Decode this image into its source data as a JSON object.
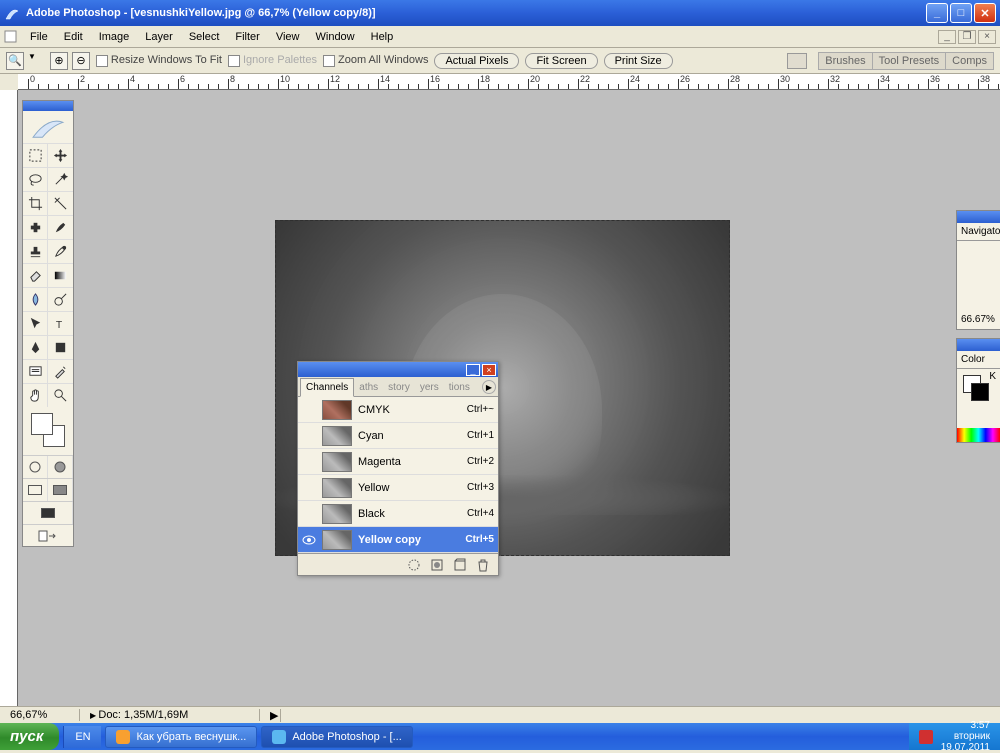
{
  "titlebar": {
    "text": "Adobe Photoshop - [vesnushkiYellow.jpg @ 66,7% (Yellow copy/8)]"
  },
  "menu": {
    "items": [
      "File",
      "Edit",
      "Image",
      "Layer",
      "Select",
      "Filter",
      "View",
      "Window",
      "Help"
    ]
  },
  "options": {
    "resize": "Resize Windows To Fit",
    "ignore": "Ignore Palettes",
    "zoomall": "Zoom All Windows",
    "actual": "Actual Pixels",
    "fit": "Fit Screen",
    "print": "Print Size",
    "well_tabs": [
      "Brushes",
      "Tool Presets",
      "Comps"
    ]
  },
  "ruler": {
    "labels": [
      "0",
      "2",
      "4",
      "6",
      "8",
      "10",
      "12",
      "14",
      "16",
      "18",
      "20",
      "22",
      "24",
      "26",
      "28",
      "30",
      "32",
      "34",
      "36",
      "38"
    ]
  },
  "channels_panel": {
    "tabs": [
      "Channels",
      "aths",
      "story",
      "yers",
      "tions"
    ],
    "rows": [
      {
        "name": "CMYK",
        "shortcut": "Ctrl+~",
        "thumb": "cmyk",
        "eye": false
      },
      {
        "name": "Cyan",
        "shortcut": "Ctrl+1",
        "thumb": "gray",
        "eye": false
      },
      {
        "name": "Magenta",
        "shortcut": "Ctrl+2",
        "thumb": "gray",
        "eye": false
      },
      {
        "name": "Yellow",
        "shortcut": "Ctrl+3",
        "thumb": "gray",
        "eye": false
      },
      {
        "name": "Black",
        "shortcut": "Ctrl+4",
        "thumb": "gray",
        "eye": false
      },
      {
        "name": "Yellow copy",
        "shortcut": "Ctrl+5",
        "thumb": "gray",
        "eye": true,
        "selected": true
      }
    ]
  },
  "navigator": {
    "tab": "Navigator",
    "zoom": "66.67%"
  },
  "color": {
    "tab": "Color",
    "mode": "K"
  },
  "status": {
    "zoom": "66,67%",
    "doc": "Doc: 1,35M/1,69M"
  },
  "taskbar": {
    "start": "пуск",
    "lang": "EN",
    "tasks": [
      {
        "label": "Как убрать веснушк...",
        "icon": "ff"
      },
      {
        "label": "Adobe Photoshop - [...",
        "icon": "ps",
        "active": true
      }
    ],
    "clock": {
      "time": "3:57",
      "day": "вторник",
      "date": "19.07.2011"
    }
  }
}
